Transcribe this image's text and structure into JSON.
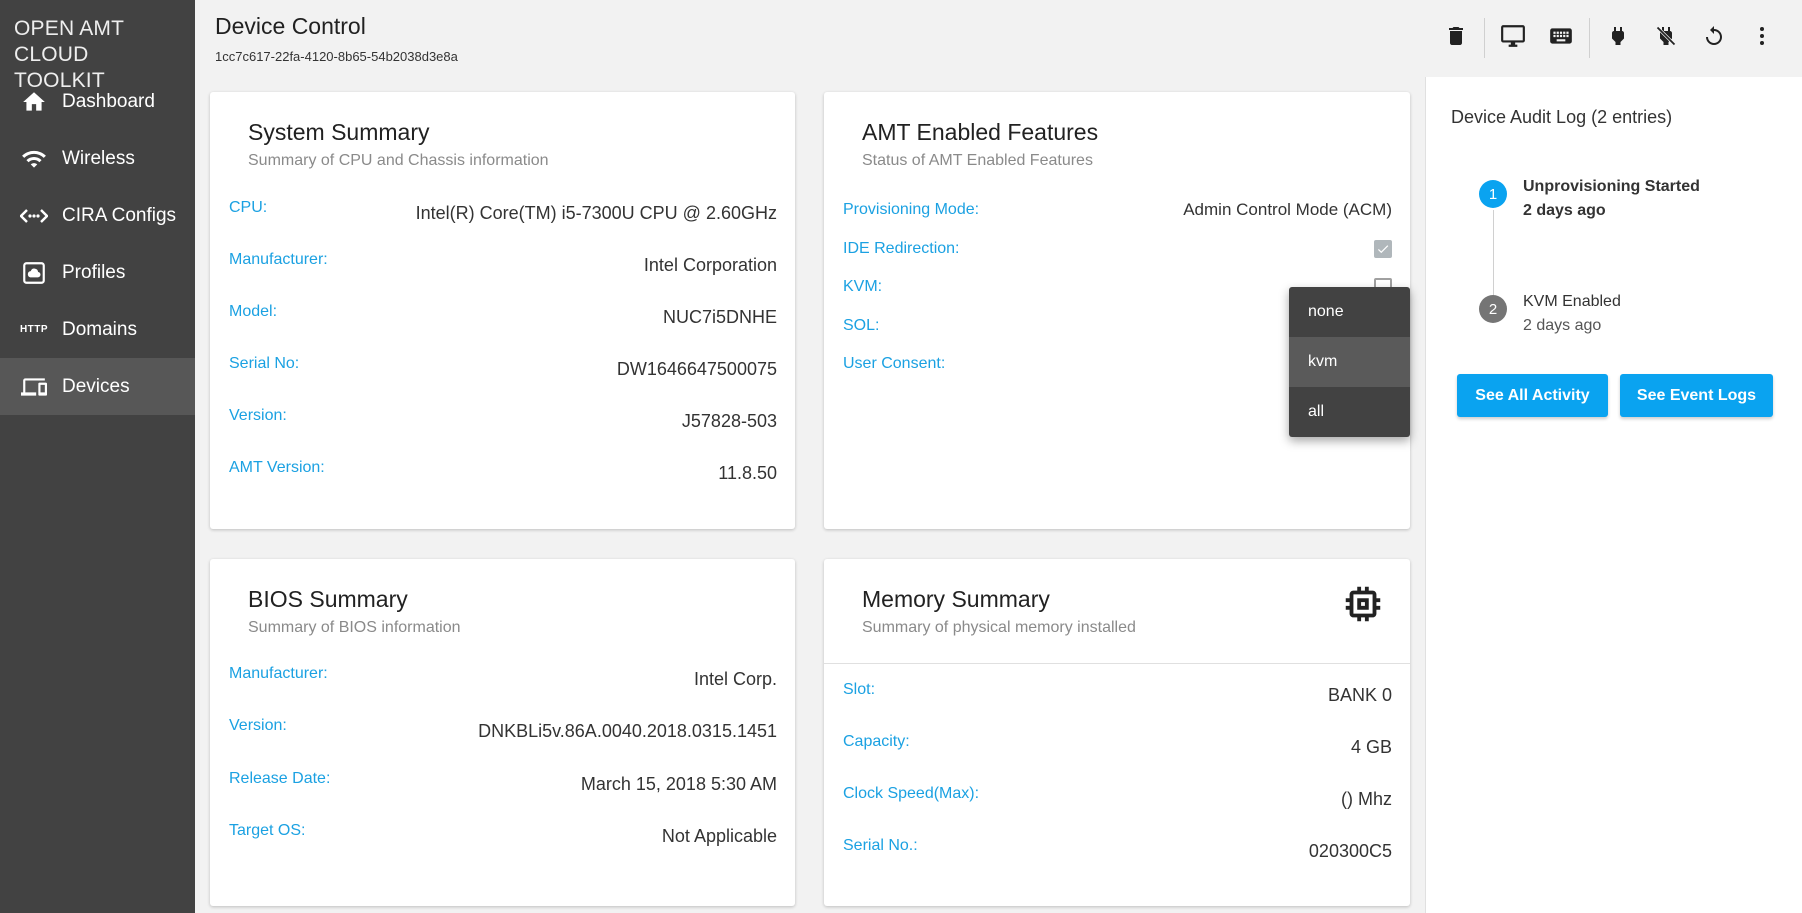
{
  "sidebar": {
    "brand_line1": "OPEN AMT",
    "brand_line2": "CLOUD TOOLKIT",
    "items": [
      {
        "label": "Dashboard",
        "icon": "home-icon"
      },
      {
        "label": "Wireless",
        "icon": "wifi-icon"
      },
      {
        "label": "CIRA Configs",
        "icon": "cira-icon"
      },
      {
        "label": "Profiles",
        "icon": "cloud-box-icon"
      },
      {
        "label": "Domains",
        "icon": "http-icon",
        "icon_text": "HTTP"
      },
      {
        "label": "Devices",
        "icon": "devices-icon",
        "active": true
      }
    ]
  },
  "header": {
    "title": "Device Control",
    "device_id": "1cc7c617-22fa-4120-8b65-54b2038d3e8a"
  },
  "system_summary": {
    "title": "System Summary",
    "subtitle": "Summary of CPU and Chassis information",
    "rows": [
      {
        "label": "CPU:",
        "value": "Intel(R) Core(TM) i5-7300U CPU @ 2.60GHz"
      },
      {
        "label": "Manufacturer:",
        "value": "Intel Corporation"
      },
      {
        "label": "Model:",
        "value": "NUC7i5DNHE"
      },
      {
        "label": "Serial No:",
        "value": "DW1646647500075"
      },
      {
        "label": "Version:",
        "value": "J57828-503"
      },
      {
        "label": "AMT Version:",
        "value": "11.8.50"
      }
    ]
  },
  "amt_features": {
    "title": "AMT Enabled Features",
    "subtitle": "Status of AMT Enabled Features",
    "provisioning_label": "Provisioning Mode:",
    "provisioning_value": "Admin Control Mode (ACM)",
    "ide_label": "IDE Redirection:",
    "ide_checked": true,
    "kvm_label": "KVM:",
    "kvm_checked": false,
    "sol_label": "SOL:",
    "user_consent_label": "User Consent:"
  },
  "consent_dropdown": {
    "options": [
      "none",
      "kvm",
      "all"
    ],
    "highlighted": "kvm"
  },
  "bios_summary": {
    "title": "BIOS Summary",
    "subtitle": "Summary of BIOS information",
    "rows": [
      {
        "label": "Manufacturer:",
        "value": "Intel Corp."
      },
      {
        "label": "Version:",
        "value": "DNKBLi5v.86A.0040.2018.0315.1451"
      },
      {
        "label": "Release Date:",
        "value": "March 15, 2018 5:30 AM"
      },
      {
        "label": "Target OS:",
        "value": "Not Applicable"
      }
    ]
  },
  "memory_summary": {
    "title": "Memory Summary",
    "subtitle": "Summary of physical memory installed",
    "rows": [
      {
        "label": "Slot:",
        "value": "BANK 0"
      },
      {
        "label": "Capacity:",
        "value": "4 GB"
      },
      {
        "label": "Clock Speed(Max):",
        "value": "() Mhz"
      },
      {
        "label": "Serial No.:",
        "value": "020300C5"
      }
    ]
  },
  "audit_log": {
    "title": "Device Audit Log (2 entries)",
    "entries": [
      {
        "number": "1",
        "event": "Unprovisioning Started",
        "time": "2 days ago"
      },
      {
        "number": "2",
        "event": "KVM Enabled",
        "time": "2 days ago"
      }
    ],
    "see_all_label": "See All Activity",
    "see_event_logs_label": "See Event Logs"
  },
  "colors": {
    "accent": "#0aa3f0",
    "label_blue": "#1ba1e2",
    "sidebar_bg": "#424242"
  }
}
